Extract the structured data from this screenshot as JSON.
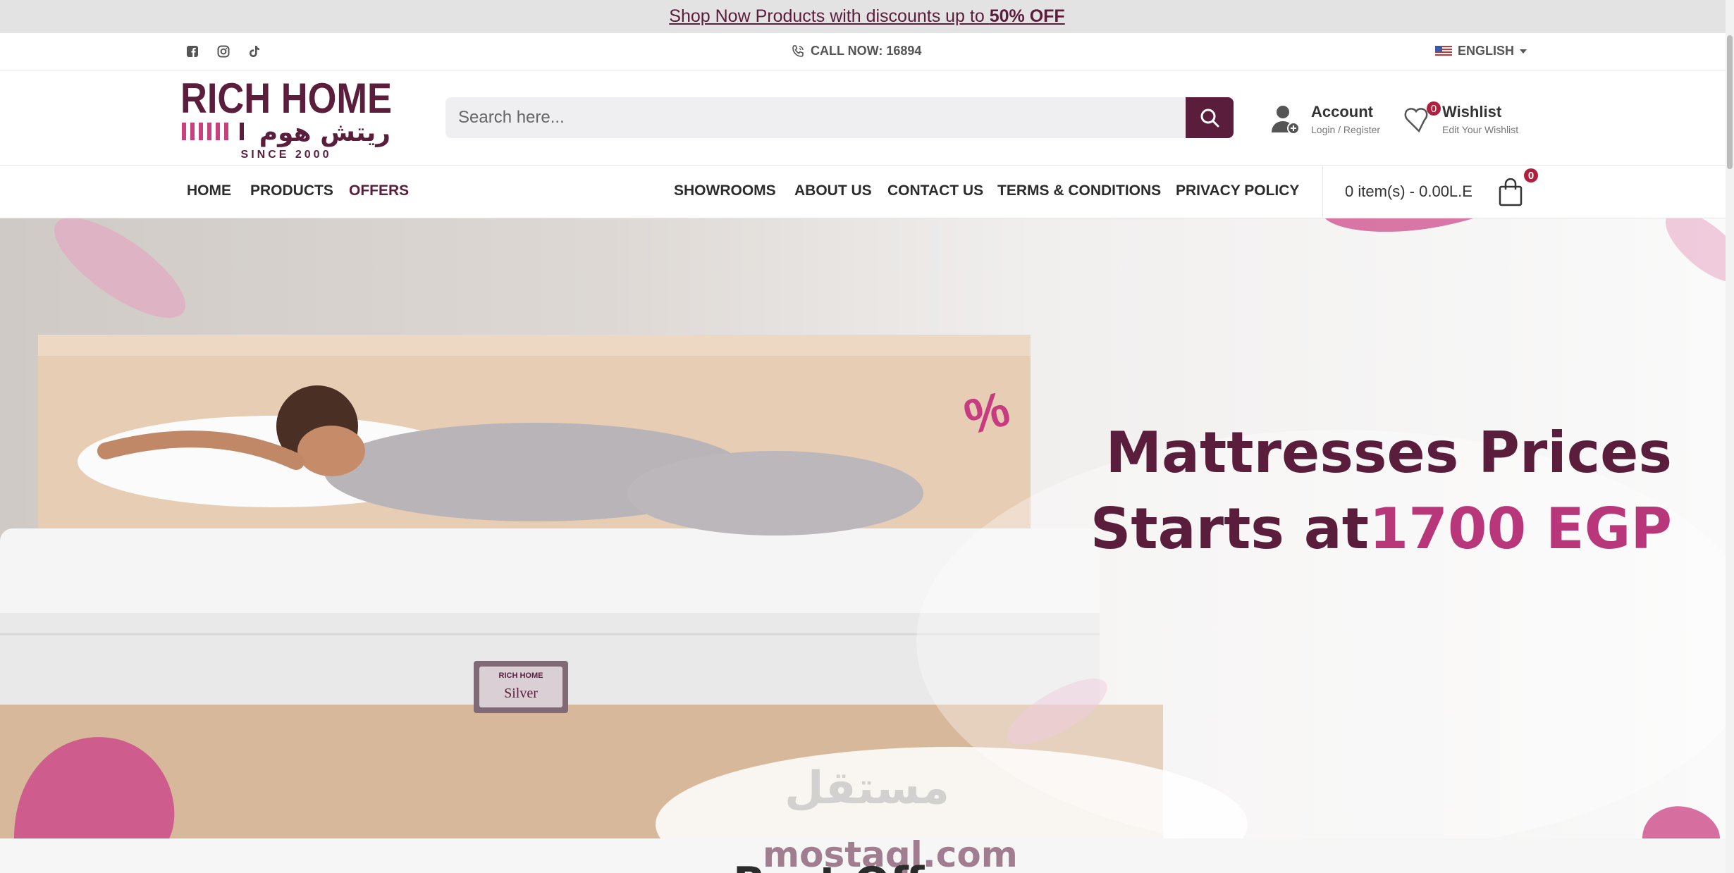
{
  "promo": {
    "text": "Shop Now Products with discounts up to ",
    "highlight": "50% OFF"
  },
  "topbar": {
    "social_icons": [
      "facebook-icon",
      "instagram-icon",
      "tiktok-icon"
    ],
    "call_label": "CALL NOW: 16894",
    "language": "ENGLISH"
  },
  "header": {
    "logo_en": "RICH HOME",
    "logo_ar": "ريتش هوم",
    "logo_since": "SINCE 2000",
    "search_placeholder": "Search here...",
    "account_title": "Account",
    "account_sub": "Login / Register",
    "wishlist_title": "Wishlist",
    "wishlist_sub": "Edit Your Wishlist",
    "wishlist_count": "0"
  },
  "nav": {
    "left": [
      "HOME",
      "PRODUCTS",
      "OFFERS"
    ],
    "right": [
      "SHOWROOMS",
      "ABOUT US",
      "CONTACT US",
      "TERMS & CONDITIONS",
      "PRIVACY POLICY"
    ],
    "cart_label": "0 item(s) - 0.00L.E",
    "cart_count": "0"
  },
  "hero": {
    "line1": "Mattresses Prices",
    "line2a": "Starts at",
    "line2b": "1700 EGP",
    "percent": "%",
    "tag_brand": "RICH HOME",
    "tag_model": "Silver",
    "watermark_ar": "مستقل",
    "watermark": "mostaql.com"
  },
  "section": {
    "title": "Best Off"
  },
  "colors": {
    "brand": "#5b1d3c",
    "accent": "#b8367a"
  }
}
